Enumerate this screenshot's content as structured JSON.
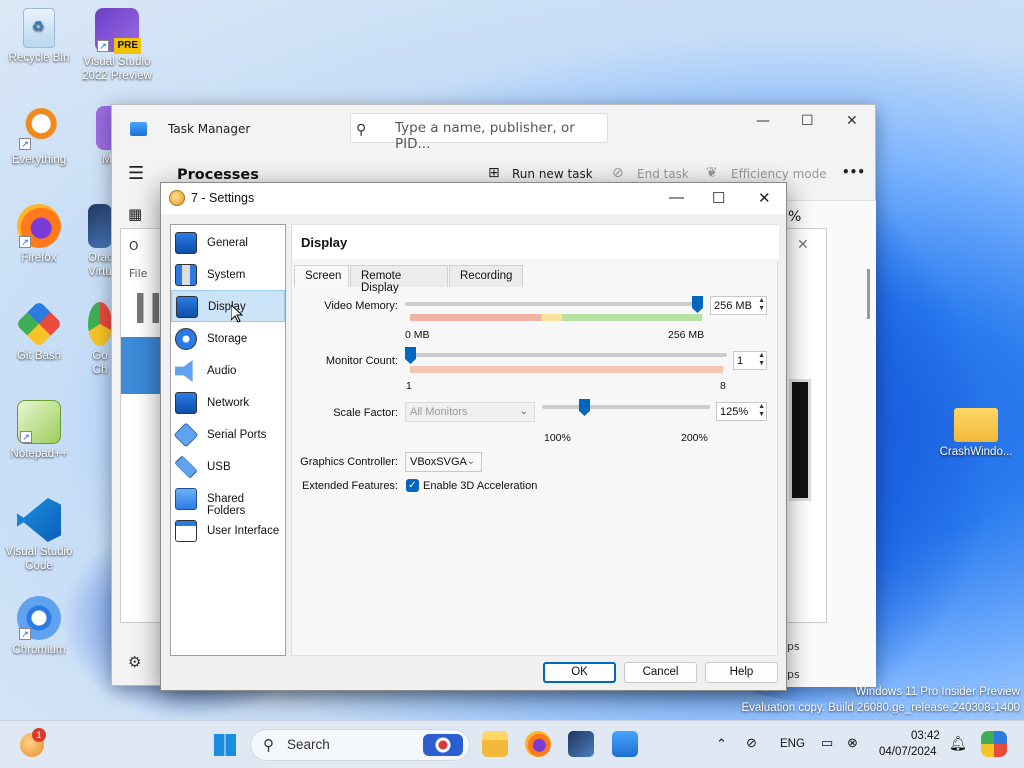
{
  "desktop": {
    "icons": [
      {
        "label": "Recycle Bin"
      },
      {
        "label": "Visual Studio 2022 Preview",
        "badge": "PRE"
      },
      {
        "label": "Everything"
      },
      {
        "label": "Firefox"
      },
      {
        "label": "Git Bash"
      },
      {
        "label": "Notepad++"
      },
      {
        "label": "Visual Studio Code"
      },
      {
        "label": "Chromium"
      },
      {
        "label": "CrashWindo..."
      }
    ],
    "partial_labels": [
      "M",
      "Orac Virtu",
      "Go Ch"
    ]
  },
  "task_manager": {
    "title": "Task Manager",
    "search_placeholder": "Type a name, publisher, or PID...",
    "page": "Processes",
    "toolbar": {
      "run_new_task": "Run new task",
      "end_task": "End task",
      "efficiency_mode": "Efficiency mode",
      "more": "•••"
    },
    "percent_fragment": "%"
  },
  "vbox_manager": {
    "file_menu": "File",
    "partial_title": "O",
    "partial_bottom": [
      "ps",
      "ps"
    ]
  },
  "settings": {
    "title": "7 - Settings",
    "nav": [
      {
        "label": "General",
        "icon": "general-icon"
      },
      {
        "label": "System",
        "icon": "system-icon"
      },
      {
        "label": "Display",
        "icon": "display-icon",
        "selected": true
      },
      {
        "label": "Storage",
        "icon": "storage-icon"
      },
      {
        "label": "Audio",
        "icon": "audio-icon"
      },
      {
        "label": "Network",
        "icon": "network-icon"
      },
      {
        "label": "Serial Ports",
        "icon": "serial-ports-icon"
      },
      {
        "label": "USB",
        "icon": "usb-icon"
      },
      {
        "label": "Shared Folders",
        "icon": "shared-folders-icon"
      },
      {
        "label": "User Interface",
        "icon": "user-interface-icon"
      }
    ],
    "panel_title": "Display",
    "tabs": [
      "Screen",
      "Remote Display",
      "Recording"
    ],
    "active_tab": "Screen",
    "video_memory": {
      "label": "Video Memory:",
      "value": "256 MB",
      "min_label": "0 MB",
      "max_label": "256 MB",
      "fraction": 1.0
    },
    "monitor_count": {
      "label": "Monitor Count:",
      "value": "1",
      "min_label": "1",
      "max_label": "8",
      "fraction": 0.0
    },
    "scale_factor": {
      "label": "Scale Factor:",
      "combo": "All Monitors",
      "value": "125%",
      "min_label": "100%",
      "max_label": "200%",
      "fraction": 0.25
    },
    "graphics_controller": {
      "label": "Graphics Controller:",
      "value": "VBoxSVGA"
    },
    "extended_features": {
      "label": "Extended Features:",
      "checkbox_label": "Enable 3D Acceleration",
      "checked": true
    },
    "buttons": {
      "ok": "OK",
      "cancel": "Cancel",
      "help": "Help"
    }
  },
  "watermark": {
    "line1": "Windows 11 Pro Insider Preview",
    "line2": "Evaluation copy. Build 26080.ge_release.240308-1400"
  },
  "taskbar": {
    "search_label": "Search",
    "notification_count": "1",
    "language": "ENG",
    "time": "03:42",
    "date": "04/07/2024"
  }
}
